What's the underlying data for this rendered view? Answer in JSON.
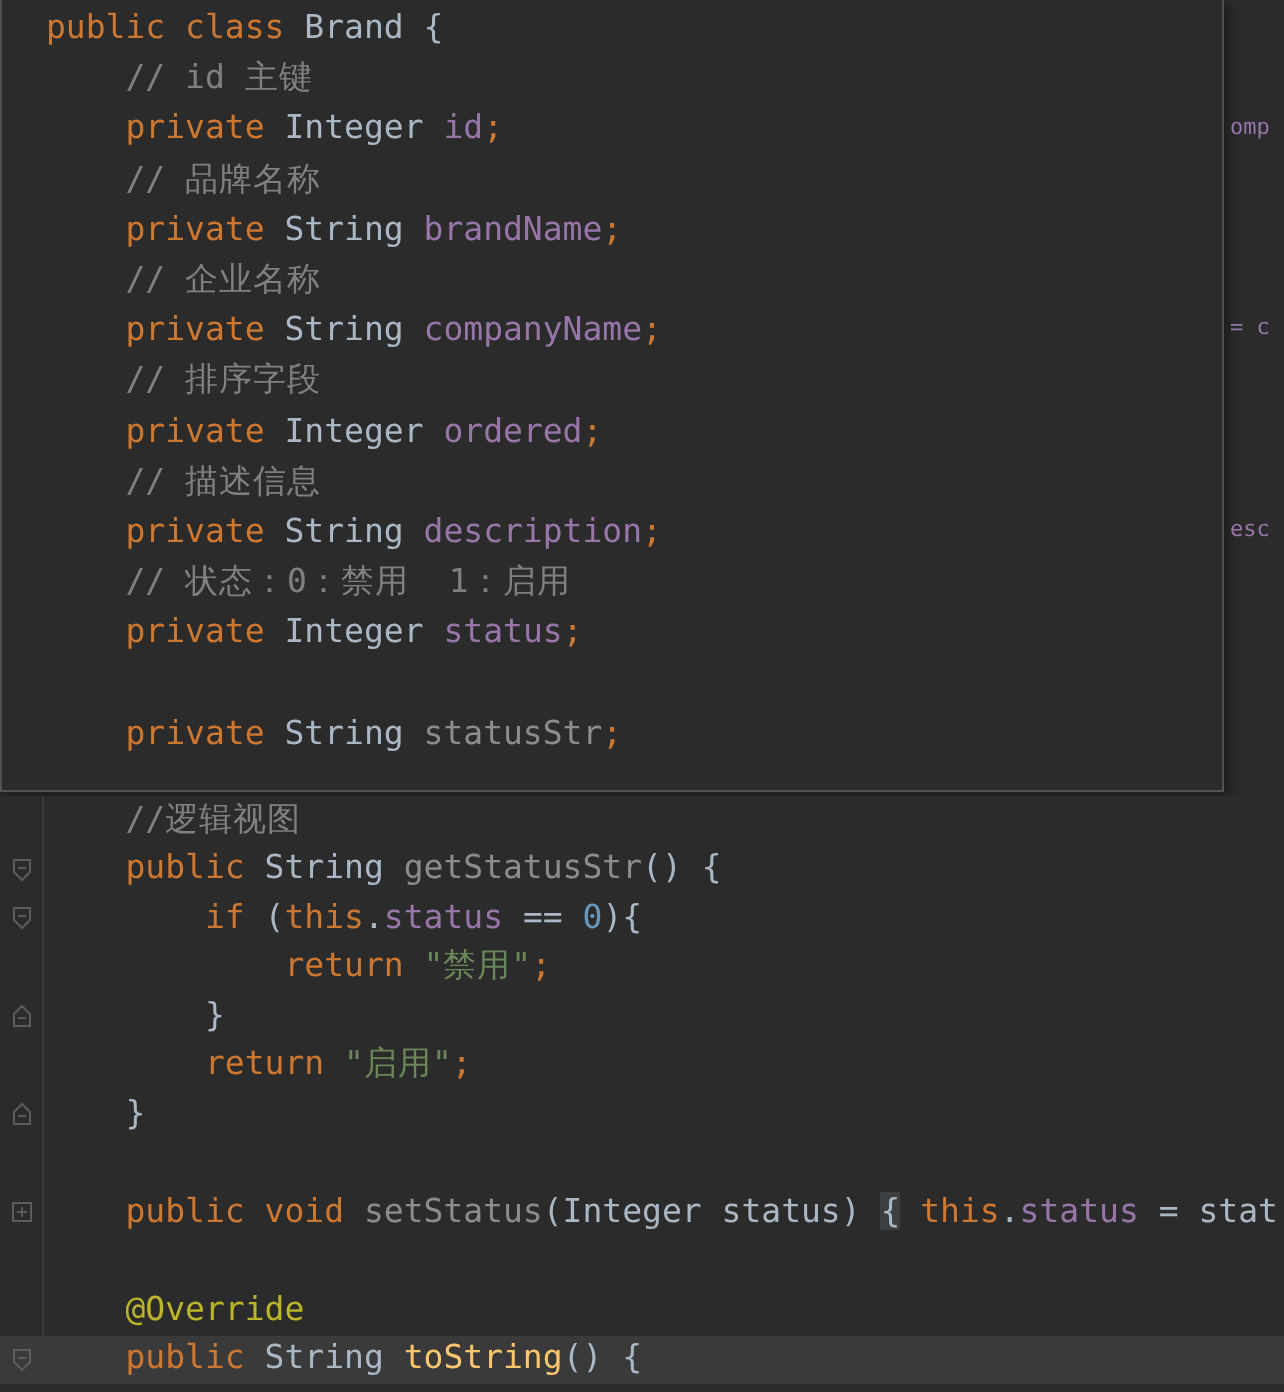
{
  "popup": {
    "lines": [
      {
        "kind": "code",
        "tokens": [
          {
            "text": "public class ",
            "kind": "keyword"
          },
          {
            "text": "Brand {",
            "kind": "plain"
          }
        ]
      },
      {
        "kind": "code",
        "tokens": [
          {
            "text": "    // id 主键",
            "kind": "comment"
          }
        ]
      },
      {
        "kind": "code",
        "tokens": [
          {
            "text": "    private ",
            "kind": "keyword"
          },
          {
            "text": "Integer ",
            "kind": "plain"
          },
          {
            "text": "id",
            "kind": "field"
          },
          {
            "text": ";",
            "kind": "keyword"
          }
        ],
        "behind": "omp"
      },
      {
        "kind": "code",
        "tokens": [
          {
            "text": "    // 品牌名称",
            "kind": "comment"
          }
        ]
      },
      {
        "kind": "code",
        "tokens": [
          {
            "text": "    private ",
            "kind": "keyword"
          },
          {
            "text": "String ",
            "kind": "plain"
          },
          {
            "text": "brandName",
            "kind": "field"
          },
          {
            "text": ";",
            "kind": "keyword"
          }
        ]
      },
      {
        "kind": "code",
        "tokens": [
          {
            "text": "    // 企业名称",
            "kind": "comment"
          }
        ]
      },
      {
        "kind": "code",
        "tokens": [
          {
            "text": "    private ",
            "kind": "keyword"
          },
          {
            "text": "String ",
            "kind": "plain"
          },
          {
            "text": "companyName",
            "kind": "field"
          },
          {
            "text": ";",
            "kind": "keyword"
          }
        ],
        "behind": "= c"
      },
      {
        "kind": "code",
        "tokens": [
          {
            "text": "    // 排序字段",
            "kind": "comment"
          }
        ]
      },
      {
        "kind": "code",
        "tokens": [
          {
            "text": "    private ",
            "kind": "keyword"
          },
          {
            "text": "Integer ",
            "kind": "plain"
          },
          {
            "text": "ordered",
            "kind": "field"
          },
          {
            "text": ";",
            "kind": "keyword"
          }
        ]
      },
      {
        "kind": "code",
        "tokens": [
          {
            "text": "    // 描述信息",
            "kind": "comment"
          }
        ]
      },
      {
        "kind": "code",
        "tokens": [
          {
            "text": "    private ",
            "kind": "keyword"
          },
          {
            "text": "String ",
            "kind": "plain"
          },
          {
            "text": "description",
            "kind": "field"
          },
          {
            "text": ";",
            "kind": "keyword"
          }
        ],
        "behind": "esc"
      },
      {
        "kind": "code",
        "tokens": [
          {
            "text": "    // 状态：0：禁用  1：启用",
            "kind": "comment"
          }
        ]
      },
      {
        "kind": "code",
        "tokens": [
          {
            "text": "    private ",
            "kind": "keyword"
          },
          {
            "text": "Integer ",
            "kind": "plain"
          },
          {
            "text": "status",
            "kind": "field"
          },
          {
            "text": ";",
            "kind": "keyword"
          }
        ]
      },
      {
        "kind": "blank"
      },
      {
        "kind": "code",
        "tokens": [
          {
            "text": "    private ",
            "kind": "keyword"
          },
          {
            "text": "String ",
            "kind": "plain"
          },
          {
            "text": "statusStr",
            "kind": "unused"
          },
          {
            "text": ";",
            "kind": "keyword"
          }
        ]
      }
    ]
  },
  "editor": {
    "lines": [
      {
        "kind": "code",
        "tokens": [
          {
            "text": "    //逻辑视图",
            "kind": "comment"
          }
        ],
        "current": false
      },
      {
        "kind": "code",
        "tokens": [
          {
            "text": "    public ",
            "kind": "keyword"
          },
          {
            "text": "String ",
            "kind": "plain"
          },
          {
            "text": "getStatusStr",
            "kind": "unused"
          },
          {
            "text": "() {",
            "kind": "plain"
          }
        ],
        "gutter": {
          "kind": "fold_start"
        },
        "current": false
      },
      {
        "kind": "code",
        "tokens": [
          {
            "text": "        if ",
            "kind": "keyword"
          },
          {
            "text": "(",
            "kind": "plain"
          },
          {
            "text": "this",
            "kind": "keyword"
          },
          {
            "text": ".",
            "kind": "plain"
          },
          {
            "text": "status",
            "kind": "field"
          },
          {
            "text": " == ",
            "kind": "plain"
          },
          {
            "text": "0",
            "kind": "number"
          },
          {
            "text": "){",
            "kind": "plain"
          }
        ],
        "gutter": {
          "kind": "fold_start"
        },
        "current": false
      },
      {
        "kind": "code",
        "tokens": [
          {
            "text": "            return ",
            "kind": "keyword"
          },
          {
            "text": "\"禁用\"",
            "kind": "string"
          },
          {
            "text": ";",
            "kind": "keyword"
          }
        ],
        "current": false
      },
      {
        "kind": "code",
        "tokens": [
          {
            "text": "        }",
            "kind": "plain"
          }
        ],
        "gutter": {
          "kind": "fold_end"
        },
        "current": false
      },
      {
        "kind": "code",
        "tokens": [
          {
            "text": "        return ",
            "kind": "keyword"
          },
          {
            "text": "\"启用\"",
            "kind": "string"
          },
          {
            "text": ";",
            "kind": "keyword"
          }
        ],
        "current": false
      },
      {
        "kind": "code",
        "tokens": [
          {
            "text": "    }",
            "kind": "plain"
          }
        ],
        "gutter": {
          "kind": "fold_end"
        },
        "current": false
      },
      {
        "kind": "blank",
        "current": false
      },
      {
        "kind": "code",
        "tokens": [
          {
            "text": "    public ",
            "kind": "keyword"
          },
          {
            "text": "void ",
            "kind": "keyword"
          },
          {
            "text": "setStatus",
            "kind": "unused"
          },
          {
            "text": "(Integer status) ",
            "kind": "plain"
          },
          {
            "text": "{",
            "kind": "folded"
          },
          {
            "text": " this",
            "kind": "keyword"
          },
          {
            "text": ".",
            "kind": "plain"
          },
          {
            "text": "status",
            "kind": "field"
          },
          {
            "text": " = stat",
            "kind": "plain"
          }
        ],
        "gutter": {
          "kind": "folded"
        },
        "current": false
      },
      {
        "kind": "blank",
        "current": false
      },
      {
        "kind": "code",
        "tokens": [
          {
            "text": "    @Override",
            "kind": "annotation"
          }
        ],
        "current": false
      },
      {
        "kind": "code",
        "tokens": [
          {
            "text": "    public ",
            "kind": "keyword"
          },
          {
            "text": "String ",
            "kind": "plain"
          },
          {
            "text": "toString",
            "kind": "method"
          },
          {
            "text": "() {",
            "kind": "plain"
          }
        ],
        "gutter": {
          "kind": "fold_start"
        },
        "current": true
      }
    ]
  }
}
